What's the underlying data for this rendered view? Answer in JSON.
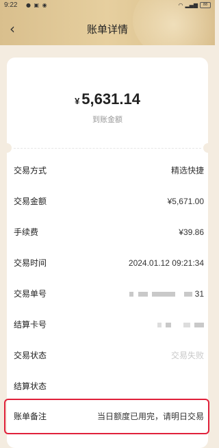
{
  "status_bar": {
    "time": "9:22",
    "battery": "88"
  },
  "header": {
    "back_icon": "chevron-left-icon",
    "title": "账单详情"
  },
  "summary": {
    "currency": "¥",
    "amount": "5,631.14",
    "amount_label": "到账金额"
  },
  "details": [
    {
      "label": "交易方式",
      "value": "精选快捷"
    },
    {
      "label": "交易金额",
      "value": "¥5,671.00"
    },
    {
      "label": "手续费",
      "value": "¥39.86"
    },
    {
      "label": "交易时间",
      "value": "2024.01.12 09:21:34"
    },
    {
      "label": "交易单号",
      "value": "31"
    },
    {
      "label": "结算卡号",
      "value": ""
    },
    {
      "label": "交易状态",
      "value": "交易失败"
    },
    {
      "label": "结算状态",
      "value": ""
    },
    {
      "label": "账单备注",
      "value": "当日额度已用完，请明日交易"
    }
  ],
  "colors": {
    "header_gold": "#d9bf8d",
    "highlight_red": "#e0203a"
  }
}
